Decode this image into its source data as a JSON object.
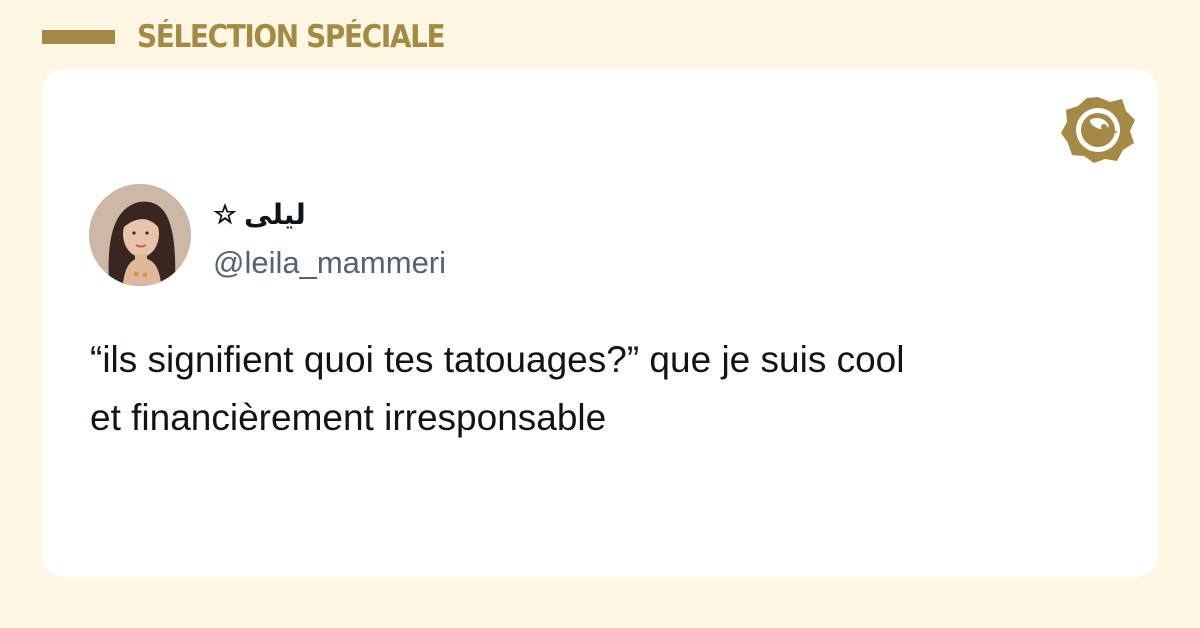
{
  "header": {
    "title": "SÉLECTION SPÉCIALE"
  },
  "tweet": {
    "display_name": "ليلى",
    "display_name_icon": "star-icon",
    "handle": "@leila_mammeri",
    "text_lines": [
      "“ils signifient quoi tes tatouages?” que je suis cool",
      "et financièrement irresponsable"
    ]
  },
  "brand": {
    "icon": "brand-logo-icon"
  },
  "colors": {
    "background": "#fdf6e3",
    "accent": "#a48a45",
    "card": "#ffffff",
    "text": "#0f1419",
    "handle": "#536471"
  }
}
